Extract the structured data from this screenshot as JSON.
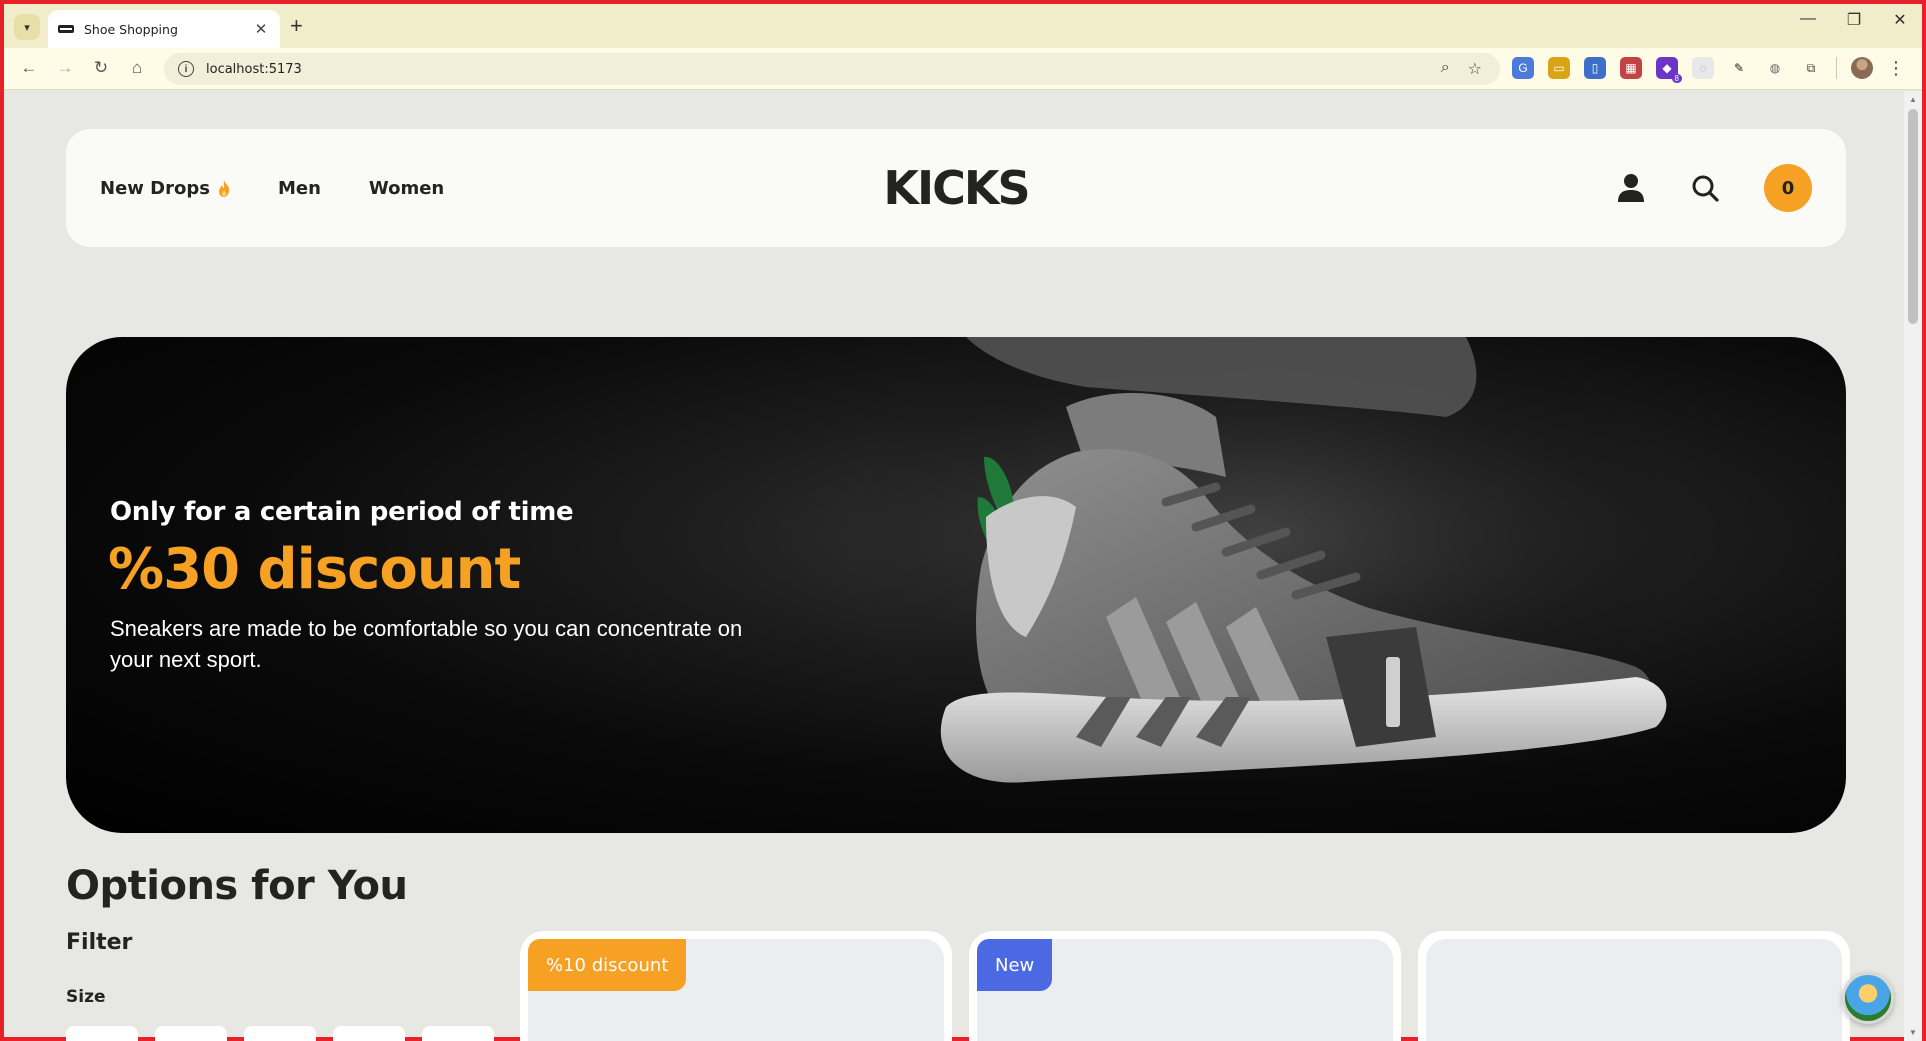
{
  "browser": {
    "tab_title": "Shoe Shopping",
    "url": "localhost:5173",
    "extensions_badge": "8"
  },
  "header": {
    "nav": [
      {
        "label": "New Drops",
        "icon": "flame-icon"
      },
      {
        "label": "Men"
      },
      {
        "label": "Women"
      }
    ],
    "logo": "KICKS",
    "cart_count": "0"
  },
  "hero": {
    "subtitle": "Only for a certain period of time",
    "title": "%30 discount",
    "text": "Sneakers are made to be comfortable so you can concentrate on your next sport."
  },
  "options": {
    "title": "Options for You",
    "filter_label": "Filter",
    "size_label": "Size"
  },
  "products": [
    {
      "badge": "%10 discount",
      "badge_color": "#f6a024"
    },
    {
      "badge": "New",
      "badge_color": "#4a69e2"
    },
    {
      "badge": ""
    }
  ],
  "colors": {
    "accent": "#f6a024",
    "blue": "#4a69e2",
    "dark": "#232321",
    "page_bg": "#e7e7e3"
  }
}
